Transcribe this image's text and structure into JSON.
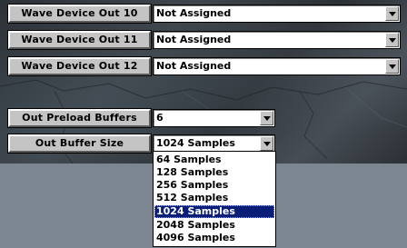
{
  "devices": [
    {
      "label": "Wave Device Out 10",
      "value": "Not Assigned"
    },
    {
      "label": "Wave Device Out 11",
      "value": "Not Assigned"
    },
    {
      "label": "Wave Device Out 12",
      "value": "Not Assigned"
    }
  ],
  "preload": {
    "label": "Out Preload Buffers",
    "value": "6"
  },
  "buffer_size": {
    "label": "Out Buffer Size",
    "value": "1024 Samples",
    "options": [
      "64 Samples",
      "128 Samples",
      "256 Samples",
      "512 Samples",
      "1024 Samples",
      "2048 Samples",
      "4096 Samples"
    ],
    "selected_index": 4
  },
  "colors": {
    "selection": "#0a1e78",
    "button_face": "#c4c4c4",
    "desktop": "#7b8690"
  }
}
